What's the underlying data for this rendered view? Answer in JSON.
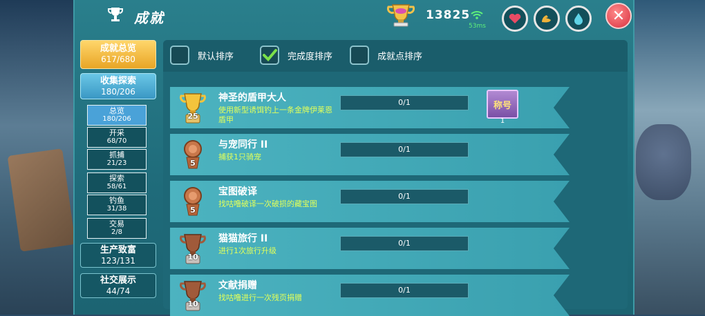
{
  "header": {
    "title": "成就",
    "score": "13825",
    "ping": "53ms",
    "icons": [
      "trophy-icon",
      "gold-cup-icon",
      "wifi-signal-icon",
      "heart-icon",
      "muscle-icon",
      "water-drop-icon",
      "close-icon"
    ]
  },
  "categories": [
    {
      "name": "成就总览",
      "count": "617/680",
      "style": "gold"
    },
    {
      "name": "收集探索",
      "count": "180/206",
      "style": "blue"
    },
    {
      "name": "生产致富",
      "count": "123/131",
      "style": "dark"
    },
    {
      "name": "社交展示",
      "count": "44/74",
      "style": "dark"
    }
  ],
  "subcategories": [
    {
      "name": "总览",
      "count": "180/206",
      "active": true
    },
    {
      "name": "开采",
      "count": "68/70",
      "active": false
    },
    {
      "name": "抓捕",
      "count": "21/23",
      "active": false
    },
    {
      "name": "探索",
      "count": "58/61",
      "active": false
    },
    {
      "name": "钓鱼",
      "count": "31/38",
      "active": false
    },
    {
      "name": "交易",
      "count": "2/8",
      "active": false
    }
  ],
  "sort_options": [
    {
      "label": "默认排序",
      "checked": false
    },
    {
      "label": "完成度排序",
      "checked": true
    },
    {
      "label": "成就点排序",
      "checked": false
    }
  ],
  "achievements": [
    {
      "name": "神圣的盾甲大人",
      "desc": "使用新型诱饵钓上一条金牌伊莱恩盾甲",
      "progress": "0/1",
      "points": "25",
      "tier": "gold",
      "reward": "称号",
      "reward_count": "1"
    },
    {
      "name": "与宠同行 II",
      "desc": "捕获1只骑宠",
      "progress": "0/1",
      "points": "5",
      "tier": "bronze"
    },
    {
      "name": "宝图破译",
      "desc": "找咕噜破译一次破损的藏宝图",
      "progress": "0/1",
      "points": "5",
      "tier": "bronze"
    },
    {
      "name": "猫猫旅行 II",
      "desc": "进行1次旅行升级",
      "progress": "0/1",
      "points": "10",
      "tier": "bronze-dark"
    },
    {
      "name": "文献捐赠",
      "desc": "找咕噜进行一次残页捐赠",
      "progress": "0/1",
      "points": "10",
      "tier": "bronze-dark"
    }
  ],
  "colors": {
    "panel": "#2a7f8c",
    "gold": "#e8a526",
    "accent_text": "#e2ff5a",
    "close": "#d8303f"
  }
}
